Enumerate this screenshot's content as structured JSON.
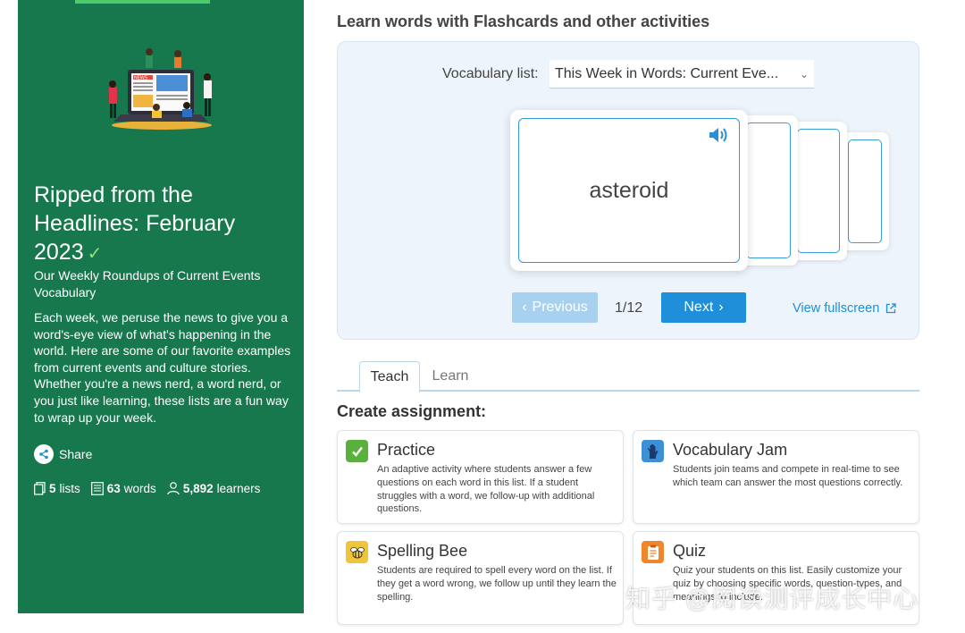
{
  "list": {
    "title": "Ripped from the Headlines: February 2023",
    "title_check": "✓",
    "subtitle": "Our Weekly Roundups of Current Events Vocabulary",
    "description": "Each week, we peruse the news to give you a word's-eye view of what's happening in the world. Here are some of our favorite examples from current events and culture stories. Whether you're a news nerd, a word nerd, or you just like learning, these lists are a fun way to wrap up your week.",
    "hero_label": "NEWS",
    "share_label": "Share",
    "stats": {
      "lists_count": "5",
      "lists_label": "lists",
      "words_count": "63",
      "words_label": "words",
      "learners_count": "5,892",
      "learners_label": "learners"
    }
  },
  "flashcards": {
    "heading": "Learn words with Flashcards and other activities",
    "vocab_label": "Vocabulary list:",
    "vocab_selected": "This Week in Words: Current Eve...",
    "current_word": "asteroid",
    "prev_label": "Previous",
    "next_label": "Next",
    "counter": "1/12",
    "fullscreen_label": "View fullscreen"
  },
  "tabs": [
    {
      "label": "Teach",
      "active": true
    },
    {
      "label": "Learn",
      "active": false
    }
  ],
  "assignment": {
    "heading": "Create assignment:",
    "activities": [
      {
        "title": "Practice",
        "icon": "checkmark-icon",
        "color": "#5ab03d",
        "description": "An adaptive activity where students answer a few questions on each word in this list. If a student struggles with a word, we follow-up with additional questions."
      },
      {
        "title": "Vocabulary Jam",
        "icon": "raised-hand-icon",
        "color": "#3d8fd6",
        "description": "Students join teams and compete in real-time to see which team can answer the most questions correctly."
      },
      {
        "title": "Spelling Bee",
        "icon": "bee-icon",
        "color": "#f2c43a",
        "description": "Students are required to spell every word on the list. If they get a word wrong, we follow up until they learn the spelling."
      },
      {
        "title": "Quiz",
        "icon": "quiz-clipboard-icon",
        "color": "#f0862b",
        "description": "Quiz your students on this list. Easily customize your quiz by choosing specific words, question-types, and meanings to include."
      }
    ]
  },
  "watermark": "知乎 @阅读测评成长中心",
  "colors": {
    "sidebar_green": "#17784e",
    "accent_blue": "#1e8fd8",
    "disabled_blue": "#a8d1ef"
  }
}
